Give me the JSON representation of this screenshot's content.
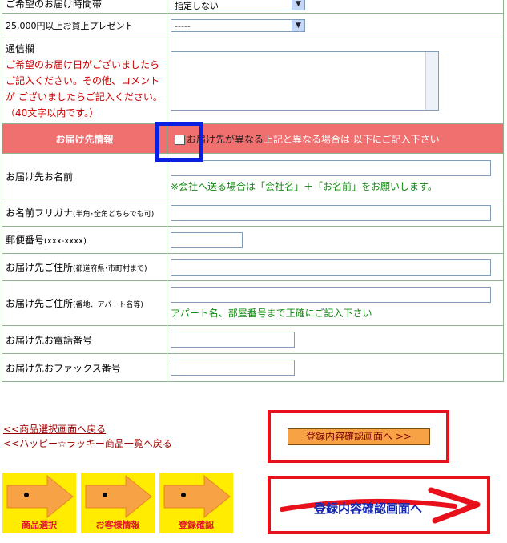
{
  "rows": {
    "time_label": "ご希望のお届け時間帯",
    "time_value": "指定しない",
    "present_label": "25,000円以上お買上プレゼント",
    "present_value": "-----",
    "message_label": "通信欄",
    "message_note": "ご希望のお届け日がございましたらご記入ください。その他、コメントが ございましたらご記入ください。（40文字以内です。）"
  },
  "shipping": {
    "header": "お届け先情報",
    "checkbox_label": "お届け先が異なる",
    "checkbox_note": "上記と異なる場合は 以下にご記入下さい",
    "name_label": "お届け先お名前",
    "name_note": "※会社へ送る場合は「会社名」＋「お名前」をお願いします。",
    "kana_label": "お名前フリガナ",
    "kana_small": "(半角･全角どちらでも可)",
    "zip_label": "郵便番号",
    "zip_small": "(xxx-xxxx)",
    "addr1_label": "お届け先ご住所",
    "addr1_small": "(都道府県･市町村まで)",
    "addr2_label": "お届け先ご住所",
    "addr2_small": "(番地、アパート名等)",
    "addr2_note": "アパート名、部屋番号まで正確にご記入下さい",
    "phone_label": "お届け先お電話番号",
    "fax_label": "お届け先おファックス番号"
  },
  "links": {
    "back_select": "<<商品選択画面へ戻る",
    "back_list": "<<ハッピー☆ラッキー商品一覧へ戻る"
  },
  "buttons": {
    "confirm": "登録内容確認画面へ >>",
    "confirm_big": "登録内容確認画面へ"
  },
  "steps": [
    "商品選択",
    "お客様情報",
    "登録確認"
  ],
  "colors": {
    "section_bg": "#f06f6f",
    "highlight": "#0a20e0",
    "frame": "#e8101a",
    "step_bg": "#ffec00"
  }
}
